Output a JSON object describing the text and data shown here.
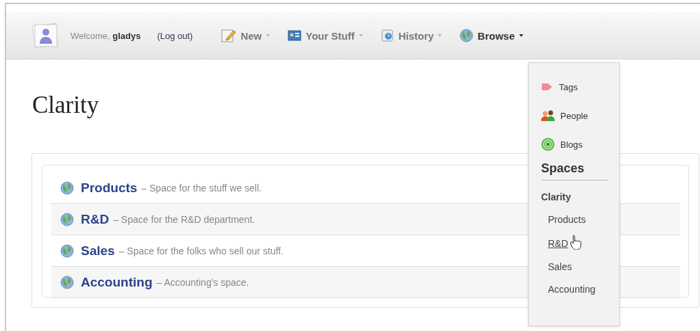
{
  "user": {
    "greeting": "Welcome,",
    "name": "gladys",
    "logout": "(Log out)"
  },
  "nav": [
    {
      "label": "New",
      "kind": "edit",
      "selected": false
    },
    {
      "label": "Your Stuff",
      "kind": "card",
      "selected": false
    },
    {
      "label": "History",
      "kind": "clock",
      "selected": false
    },
    {
      "label": "Browse",
      "kind": "globe",
      "selected": true
    }
  ],
  "title": "Clarity",
  "spaces": [
    {
      "name": "Products",
      "description": "– Space for the stuff we sell."
    },
    {
      "name": "R&D",
      "description": "– Space for the R&D department."
    },
    {
      "name": "Sales",
      "description": "– Space for the folks who sell our stuff."
    },
    {
      "name": "Accounting",
      "description": "– Accounting's space."
    }
  ],
  "menu": {
    "items": [
      {
        "label": "Tags",
        "kind": "tag"
      },
      {
        "label": "People",
        "kind": "people"
      },
      {
        "label": "Blogs",
        "kind": "feed"
      }
    ],
    "heading": "Spaces",
    "group": "Clarity",
    "subitems": [
      {
        "label": "Products",
        "hovered": false
      },
      {
        "label": "R&D",
        "hovered": true
      },
      {
        "label": "Sales",
        "hovered": false
      },
      {
        "label": "Accounting",
        "hovered": false
      }
    ]
  }
}
